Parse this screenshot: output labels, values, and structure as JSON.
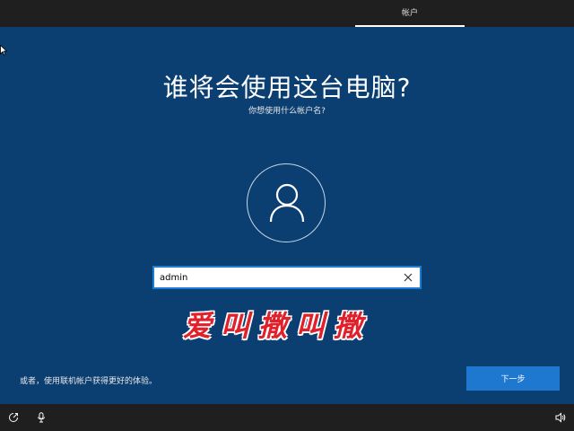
{
  "header": {
    "tab_label": "帐户"
  },
  "main": {
    "title": "谁将会使用这台电脑?",
    "subtitle": "你想使用什么帐户名?",
    "name_input": {
      "value": "admin",
      "placeholder": ""
    }
  },
  "watermark": {
    "chars": [
      "爱",
      "叫",
      "撒",
      "叫",
      "撒"
    ]
  },
  "footer": {
    "online_account_link": "或者，使用联机帐户获得更好的体验。",
    "next_button": "下一步"
  },
  "taskbar": {
    "icons": [
      "ease-of-access-icon",
      "microphone-icon",
      "volume-icon"
    ]
  },
  "colors": {
    "background": "#0b3f72",
    "bar": "#1f1f1f",
    "accent": "#1e78cf",
    "watermark": "#e0202a"
  }
}
